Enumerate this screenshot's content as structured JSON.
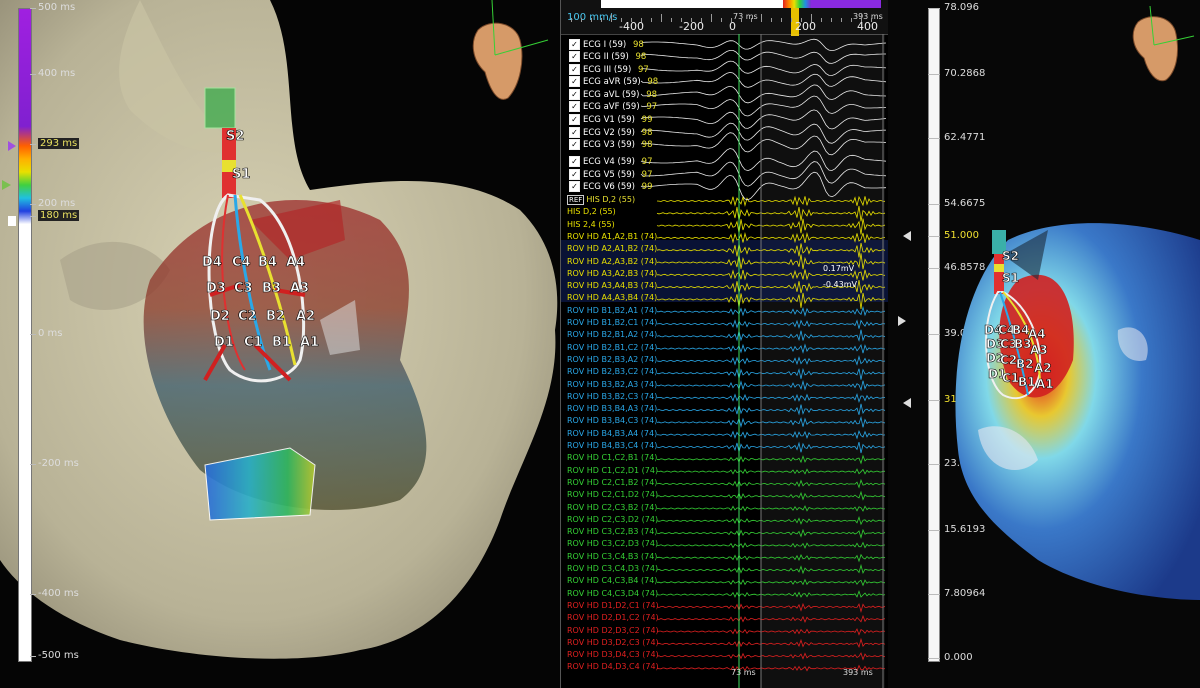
{
  "left_scale": {
    "labels": [
      "500 ms",
      "400 ms",
      "293 ms",
      "200 ms",
      "180 ms",
      "0 ms",
      "-200 ms",
      "-400 ms",
      "-500 ms"
    ]
  },
  "left_map": {
    "electrodes": [
      "S2",
      "S1",
      "D4",
      "C4",
      "B4",
      "A4",
      "D3",
      "C3",
      "B3",
      "A3",
      "D2",
      "C2",
      "B2",
      "A2",
      "D1",
      "C1",
      "B1",
      "A1"
    ]
  },
  "center": {
    "speed": "100 mm/s",
    "ticks": [
      "-400",
      "-200",
      "0",
      "200",
      "400"
    ],
    "marker_top": "73 ms",
    "marker_top_right": "393 ms",
    "marker_bottom": "73 ms",
    "marker_bottom_right": "393 ms",
    "amp_labels": [
      "0.17mV",
      "-0.43mV"
    ],
    "ecg": [
      {
        "name": "ECG I (59)",
        "val": "98"
      },
      {
        "name": "ECG II (59)",
        "val": "98"
      },
      {
        "name": "ECG III (59)",
        "val": "97"
      },
      {
        "name": "ECG aVR (59)",
        "val": "98"
      },
      {
        "name": "ECG aVL (59)",
        "val": "98"
      },
      {
        "name": "ECG aVF (59)",
        "val": "97"
      },
      {
        "name": "ECG V1 (59)",
        "val": "99"
      },
      {
        "name": "ECG V2 (59)",
        "val": "98"
      },
      {
        "name": "ECG V3 (59)",
        "val": "98"
      },
      {
        "name": "ECG V4 (59)",
        "val": "97"
      },
      {
        "name": "ECG V5 (59)",
        "val": "97"
      },
      {
        "name": "ECG V6 (59)",
        "val": "99"
      }
    ],
    "ref_label": "REF",
    "ref_trace": "HIS D,2 (55)",
    "his": [
      "HIS D,2 (55)",
      "HIS 2,4 (55)"
    ],
    "yellow": [
      "ROV HD  A1,A2,B1 (74)",
      "ROV HD  A2,A1,B2 (74)",
      "ROV HD  A2,A3,B2 (74)",
      "ROV HD  A3,A2,B3 (74)",
      "ROV HD  A3,A4,B3 (74)",
      "ROV HD  A4,A3,B4 (74)"
    ],
    "blue": [
      "ROV HD  B1,B2,A1 (74)",
      "ROV HD  B1,B2,C1 (74)",
      "ROV HD  B2,B1,A2 (74)",
      "ROV HD  B2,B1,C2 (74)",
      "ROV HD  B2,B3,A2 (74)",
      "ROV HD  B2,B3,C2 (74)",
      "ROV HD  B3,B2,A3 (74)",
      "ROV HD  B3,B2,C3 (74)",
      "ROV HD  B3,B4,A3 (74)",
      "ROV HD  B3,B4,C3 (74)",
      "ROV HD  B4,B3,A4 (74)",
      "ROV HD  B4,B3,C4 (74)"
    ],
    "green": [
      "ROV HD  C1,C2,B1 (74)",
      "ROV HD  C1,C2,D1 (74)",
      "ROV HD  C2,C1,B2 (74)",
      "ROV HD  C2,C1,D2 (74)",
      "ROV HD  C2,C3,B2 (74)",
      "ROV HD  C2,C3,D2 (74)",
      "ROV HD  C3,C2,B3 (74)",
      "ROV HD  C3,C2,D3 (74)",
      "ROV HD  C3,C4,B3 (74)",
      "ROV HD  C3,C4,D3 (74)",
      "ROV HD  C4,C3,B4 (74)",
      "ROV HD  C4,C3,D4 (74)"
    ],
    "red": [
      "ROV HD  D1,D2,C1 (74)",
      "ROV HD  D2,D1,C2 (74)",
      "ROV HD  D2,D3,C2 (74)",
      "ROV HD  D3,D2,C3 (74)",
      "ROV HD  D3,D4,C3 (74)",
      "ROV HD  D4,D3,C4 (74)"
    ]
  },
  "right_scale": {
    "labels": [
      "78.096",
      "70.2868",
      "62.4771",
      "54.6675",
      "51.000",
      "46.8578",
      "39.0482",
      "31.000",
      "23.4289",
      "15.6193",
      "7.80964",
      "0.000"
    ]
  },
  "right_map": {
    "electrodes": [
      "S2",
      "S1",
      "D4",
      "C4",
      "B4",
      "A4",
      "D3",
      "C3",
      "B3",
      "A3",
      "D2",
      "C2",
      "B2",
      "A2",
      "D1",
      "C1",
      "B1",
      "A1"
    ]
  },
  "colors": {
    "yellow": "#e8e000",
    "blue": "#2aa8e8",
    "green": "#35d035",
    "red": "#e02020",
    "white": "#f0f0f0"
  }
}
